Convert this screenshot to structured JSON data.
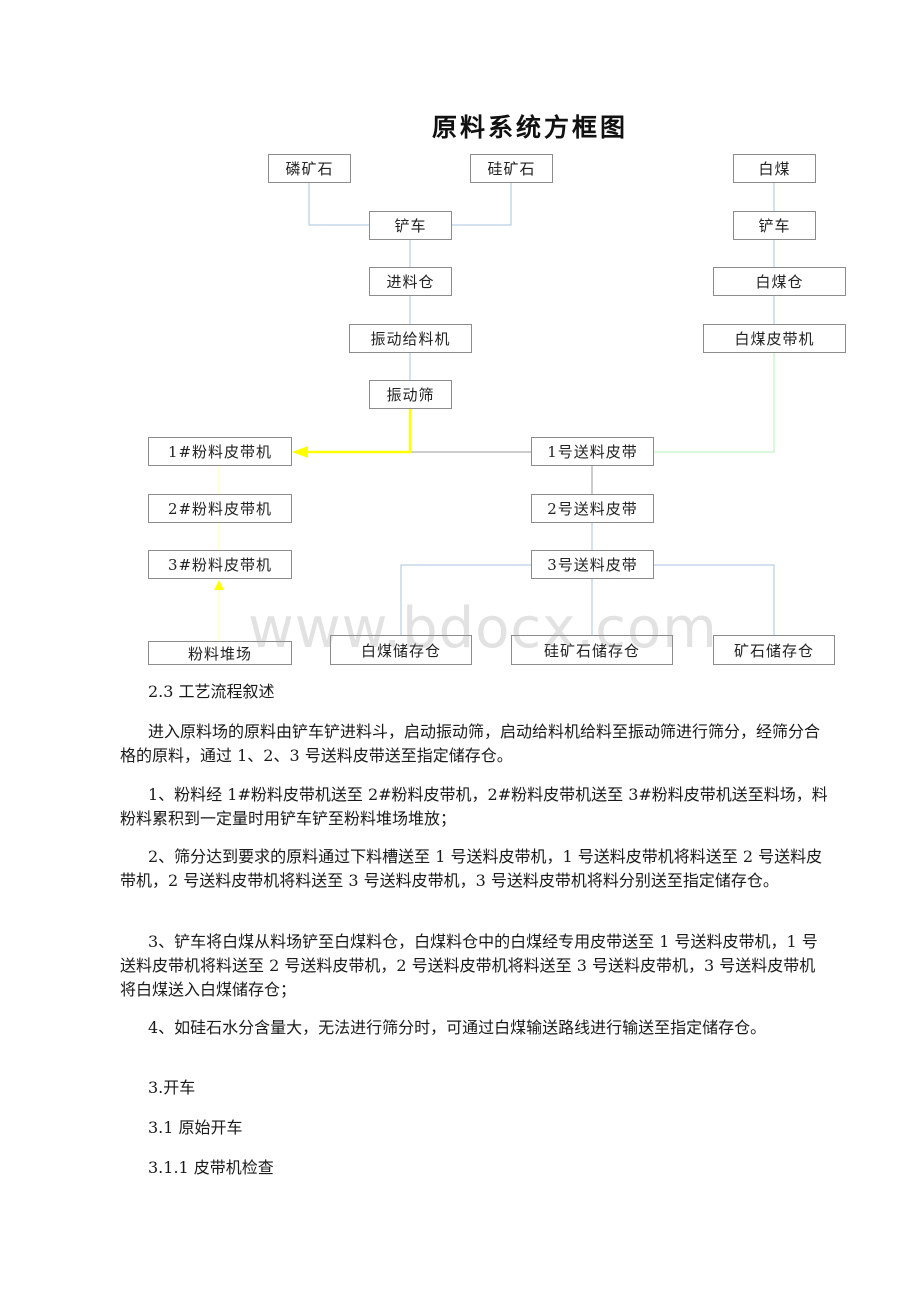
{
  "diagram": {
    "title": "原料系统方框图",
    "watermark": "www.bdocx.com",
    "nodes": {
      "phosphate_ore": "磷矿石",
      "silica_ore": "硅矿石",
      "white_coal": "白煤",
      "loader_left": "铲车",
      "loader_right": "铲车",
      "feed_bin": "进料仓",
      "white_coal_bin": "白煤仓",
      "vibrating_feeder": "振动给料机",
      "white_coal_belt": "白煤皮带机",
      "vibrating_screen": "振动筛",
      "powder_belt_1": "1#粉料皮带机",
      "feed_belt_1": "1号送料皮带",
      "powder_belt_2": "2#粉料皮带机",
      "feed_belt_2": "2号送料皮带",
      "powder_belt_3": "3#粉料皮带机",
      "feed_belt_3": "3号送料皮带",
      "powder_yard": "粉料堆场",
      "white_coal_storage": "白煤储存仓",
      "silica_storage": "硅矿石储存仓",
      "ore_storage": "矿石储存仓"
    },
    "colors": {
      "line_default": "#a9c3dd",
      "line_gray": "#9a9a9a",
      "line_yellow": "#ffff00",
      "line_green": "#b6f0b6"
    }
  },
  "text": {
    "section_heading": "2.3 工艺流程叙述",
    "paragraphs": [
      "进入原料场的原料由铲车铲进料斗，启动振动筛，启动给料机给料至振动筛进行筛分，经筛分合格的原料，通过 1、2、3 号送料皮带送至指定储存仓。",
      "1、粉料经 1#粉料皮带机送至 2#粉料皮带机，2#粉料皮带机送至 3#粉料皮带机送至料场，料粉料累积到一定量时用铲车铲至粉料堆场堆放；",
      "2、筛分达到要求的原料通过下料槽送至 1 号送料皮带机，1 号送料皮带机将料送至 2 号送料皮带机，2 号送料皮带机将料送至 3 号送料皮带机，3 号送料皮带机将料分别送至指定储存仓。",
      "3、铲车将白煤从料场铲至白煤料仓，白煤料仓中的白煤经专用皮带送至 1 号送料皮带机，1 号送料皮带机将料送至 2 号送料皮带机，2 号送料皮带机将料送至 3 号送料皮带机，3 号送料皮带机将白煤送入白煤储存仓；",
      "4、如硅石水分含量大，无法进行筛分时，可通过白煤输送路线进行输送至指定储存仓。"
    ],
    "heading_3": "3.开车",
    "heading_3_1": "3.1 原始开车",
    "heading_3_1_1": "3.1.1 皮带机检查"
  }
}
